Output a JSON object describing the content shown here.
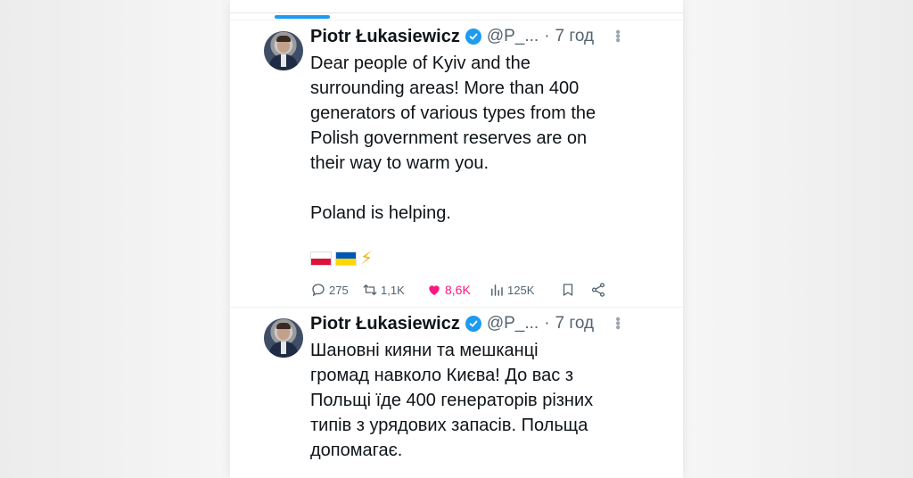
{
  "tweets": [
    {
      "author": "Piotr Łukasiewicz",
      "handle": "@P_...",
      "separator": "·",
      "time": "7 год",
      "text": "Dear people of Kyiv and the\nsurrounding areas! More than 400\ngenerators of various types from the\nPolish government reserves are on\ntheir way to warm you.\n\nPoland is helping.",
      "emojis": [
        "flag-poland",
        "flag-ukraine",
        "lightning-bolt"
      ],
      "bolt": "⚡",
      "stats": {
        "replies": "275",
        "retweets": "1,1K",
        "likes": "8,6K",
        "views": "125K"
      }
    },
    {
      "author": "Piotr Łukasiewicz",
      "handle": "@P_...",
      "separator": "·",
      "time": "7 год",
      "text": "Шановні кияни та мешканці\nгромад навколо Києва! До вас з\nПольщі їде 400 генераторів різних\nтипів з урядових запасів. Польща\nдопомагає."
    }
  ],
  "colors": {
    "accent": "#1d9bf0",
    "like": "#f91880",
    "muted": "#536471"
  },
  "icons": [
    "verified-badge-icon",
    "more-options-icon",
    "reply-icon",
    "retweet-icon",
    "heart-icon",
    "views-icon",
    "bookmark-icon",
    "share-icon"
  ]
}
